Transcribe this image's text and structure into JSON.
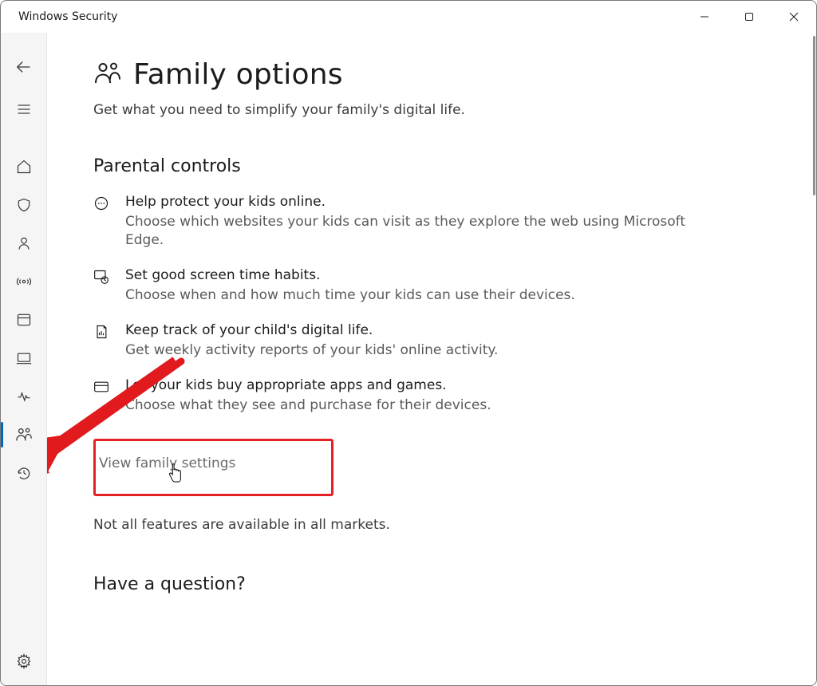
{
  "window": {
    "title": "Windows Security"
  },
  "page": {
    "title": "Family options",
    "subtitle": "Get what you need to simplify your family's digital life."
  },
  "section": {
    "parental_heading": "Parental controls"
  },
  "features": [
    {
      "title": "Help protect your kids online.",
      "desc": "Choose which websites your kids can visit as they explore the web using Microsoft Edge."
    },
    {
      "title": "Set good screen time habits.",
      "desc": "Choose when and how much time your kids can use their devices."
    },
    {
      "title": "Keep track of your child's digital life.",
      "desc": "Get weekly activity reports of your kids' online activity."
    },
    {
      "title": "Let your kids buy appropriate apps and games.",
      "desc": "Choose what they see and purchase for their devices."
    }
  ],
  "link": {
    "view_family_settings": "View family settings"
  },
  "note": "Not all features are available in all markets.",
  "question_heading": "Have a question?"
}
